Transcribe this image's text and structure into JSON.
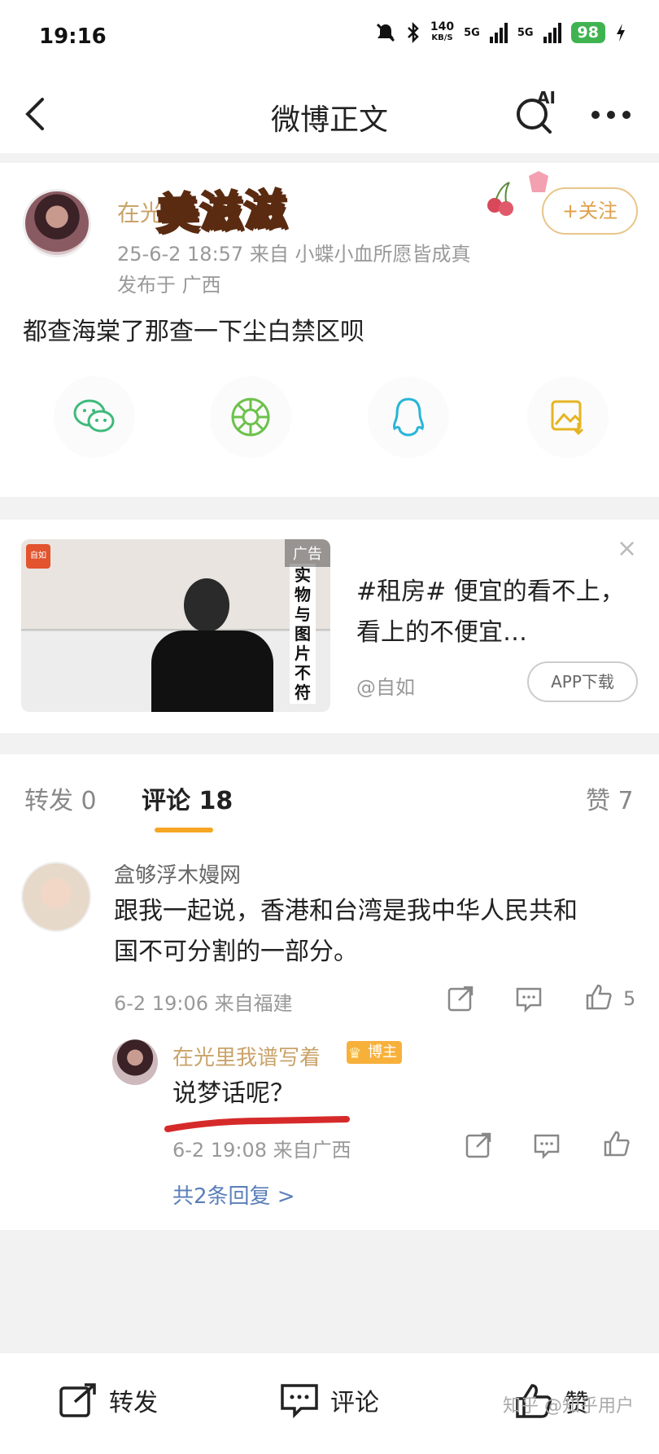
{
  "status_bar": {
    "time": "19:16",
    "net_speed": "140",
    "net_unit": "KB/S",
    "sim1": "5G",
    "sim2": "5G",
    "battery": "98"
  },
  "nav": {
    "title": "微博正文",
    "ai_label": "AI"
  },
  "post": {
    "author_visible": "在光",
    "sticker_text": "美滋滋",
    "meta": "25-6-2 18:57 来自 小蝶小血所愿皆成真",
    "location": "发布于 广西",
    "follow_label": "+关注",
    "text": "都查海棠了那查一下尘白禁区呗"
  },
  "share_icons": [
    "wechat-icon",
    "moments-icon",
    "qq-icon",
    "save-image-icon"
  ],
  "ad": {
    "badge": "广告",
    "logo_text": "自如",
    "vertical_text": "实物与图片不符",
    "text": "#租房# 便宜的看不上，看上的不便宜…",
    "source": "@自如",
    "app_button": "APP下载",
    "close": "×"
  },
  "tabs": {
    "repost": "转发 0",
    "comments": "评论 18",
    "likes": "赞 7"
  },
  "comment": {
    "name": "盒够浮木嫚网",
    "text_line1": "跟我一起说，香港和台湾是我中华人民共和",
    "text_line2": "国不可分割的一部分。",
    "meta": "6-2 19:06 来自福建",
    "likes": "5"
  },
  "reply": {
    "name": "在光里我谱写着",
    "badge": "博主",
    "text": "说梦话呢？",
    "meta": "6-2 19:08 来自广西",
    "more": "共2条回复 >"
  },
  "bottom_bar": {
    "repost": "转发",
    "comment": "评论",
    "like": "赞"
  },
  "watermark": "知乎 @知乎用户",
  "colors": {
    "accent_orange": "#f5a623",
    "author_gold": "#c9a36a",
    "link_blue": "#5b7fb8",
    "battery_green": "#3fb34f"
  }
}
